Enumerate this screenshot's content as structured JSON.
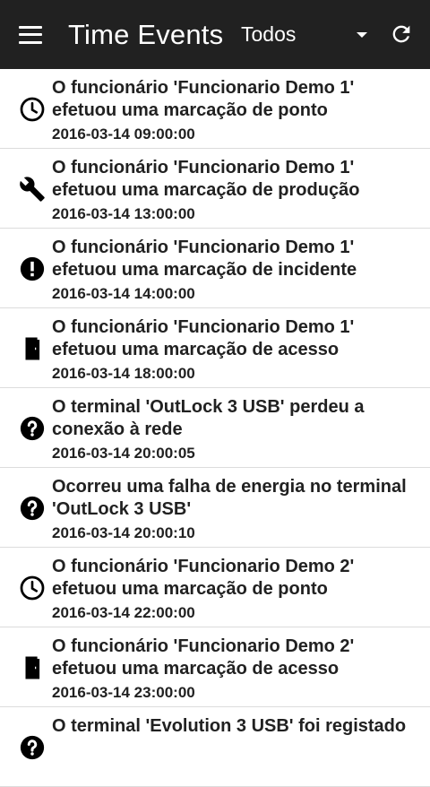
{
  "header": {
    "title": "Time Events",
    "filter_value": "Todos"
  },
  "events": [
    {
      "icon": "clock-icon",
      "line1": "O funcionário 'Funcionario Demo 1'",
      "line2": "efetuou uma marcação de ponto",
      "time": "2016-03-14 09:00:00"
    },
    {
      "icon": "wrench-icon",
      "line1": "O funcionário 'Funcionario Demo 1'",
      "line2": "efetuou uma marcação de produção",
      "time": "2016-03-14 13:00:00"
    },
    {
      "icon": "alert-icon",
      "line1": "O funcionário 'Funcionario Demo 1'",
      "line2": "efetuou uma marcação de incidente",
      "time": "2016-03-14 14:00:00"
    },
    {
      "icon": "door-icon",
      "line1": "O funcionário 'Funcionario Demo 1'",
      "line2": "efetuou uma marcação de acesso",
      "time": "2016-03-14 18:00:00"
    },
    {
      "icon": "help-icon",
      "line1": "O terminal 'OutLock 3 USB' perdeu a",
      "line2": "conexão à rede",
      "time": "2016-03-14 20:00:05"
    },
    {
      "icon": "help-icon",
      "line1": "Ocorreu uma falha de energia no terminal",
      "line2": "'OutLock 3 USB'",
      "time": "2016-03-14 20:00:10"
    },
    {
      "icon": "clock-icon",
      "line1": "O funcionário 'Funcionario Demo 2'",
      "line2": "efetuou uma marcação de ponto",
      "time": "2016-03-14 22:00:00"
    },
    {
      "icon": "door-icon",
      "line1": "O funcionário 'Funcionario Demo 2'",
      "line2": "efetuou uma marcação de acesso",
      "time": "2016-03-14 23:00:00"
    },
    {
      "icon": "help-icon",
      "line1": "O terminal 'Evolution 3 USB' foi registado",
      "line2": "",
      "time": ""
    }
  ]
}
